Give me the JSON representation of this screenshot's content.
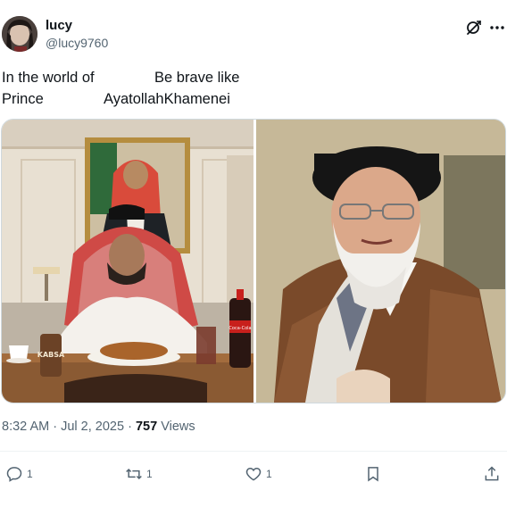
{
  "author": {
    "name": "lucy",
    "handle": "@lucy9760"
  },
  "tweet": {
    "col1": [
      "In the world of",
      "Prince"
    ],
    "col2": [
      "Be brave like",
      "AyatollahKhamenei"
    ]
  },
  "media": {
    "left_label": "KABSA",
    "bottle_label": "Coca-Cola"
  },
  "meta": {
    "time": "8:32 AM",
    "sep": "·",
    "date": "Jul 2, 2025",
    "views_count": "757",
    "views_label": "Views"
  },
  "actions": {
    "reply_count": "1",
    "repost_count": "1",
    "like_count": "1"
  },
  "colors": {
    "text": "#0f1419",
    "secondary": "#536471",
    "border": "#cfd9de"
  }
}
